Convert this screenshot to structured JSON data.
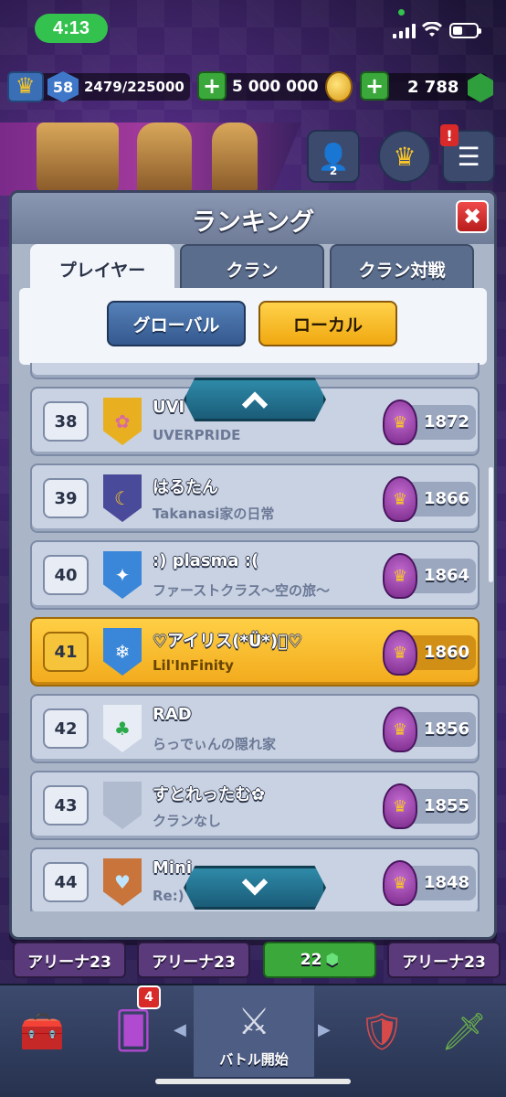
{
  "status_bar": {
    "time": "4:13"
  },
  "resources": {
    "level": "58",
    "experience": "2479/225000",
    "gold": "5 000 000",
    "gems": "2 788"
  },
  "header": {
    "friends_count": "2",
    "notification": "!"
  },
  "modal": {
    "title": "ランキング",
    "close_label": "✖",
    "tabs": [
      {
        "label": "プレイヤー",
        "active": true
      },
      {
        "label": "クラン",
        "active": false
      },
      {
        "label": "クラン対戦",
        "active": false
      }
    ],
    "filters": {
      "global_label": "グローバル",
      "local_label": "ローカル",
      "selected": "local"
    },
    "rows": [
      {
        "rank": "38",
        "name": "UVI",
        "clan": "UVERPRIDE",
        "trophies": "1872",
        "badge_color": "#e8b020",
        "badge_icon": "sakura-icon",
        "badge_glyph": "✿",
        "me": false
      },
      {
        "rank": "39",
        "name": "はるたん",
        "clan": "Takanasi家の日常",
        "trophies": "1866",
        "badge_color": "#4a4a9a",
        "badge_icon": "moon-icon",
        "badge_glyph": "☾",
        "me": false
      },
      {
        "rank": "40",
        "name": ":) plasma :(",
        "clan": "ファーストクラス～空の旅～",
        "trophies": "1864",
        "badge_color": "#3a86d8",
        "badge_icon": "star-icon",
        "badge_glyph": "✦",
        "me": false
      },
      {
        "rank": "41",
        "name": "♡アイリス(*Ü*)ﾞ♡",
        "clan": "Lil'InFinity",
        "trophies": "1860",
        "badge_color": "#3a86d8",
        "badge_icon": "snowflake-icon",
        "badge_glyph": "❄",
        "me": true
      },
      {
        "rank": "42",
        "name": "RAD",
        "clan": "らっでぃんの隠れ家",
        "trophies": "1856",
        "badge_color": "#e8edf5",
        "badge_icon": "clover-icon",
        "badge_glyph": "♣",
        "me": false
      },
      {
        "rank": "43",
        "name": "すとれったむ✿",
        "clan": "クランなし",
        "trophies": "1855",
        "badge_color": "#b0bbd0",
        "badge_icon": "empty-shield-icon",
        "badge_glyph": "",
        "me": false
      },
      {
        "rank": "44",
        "name": "Mini",
        "clan": "Re:)",
        "trophies": "1848",
        "badge_color": "#c8743a",
        "badge_icon": "heart-icon",
        "badge_glyph": "♥",
        "me": false
      }
    ]
  },
  "arenas": [
    {
      "label": "アリーナ23"
    },
    {
      "label": "アリーナ23"
    },
    {
      "label": "22"
    },
    {
      "label": "アリーナ23"
    }
  ],
  "bottom_nav": {
    "cards_badge": "4",
    "battle_label": "バトル開始"
  },
  "colors": {
    "accent_gold": "#f2aa1c",
    "accent_blue": "#34598f",
    "close_red": "#d92a2a"
  }
}
